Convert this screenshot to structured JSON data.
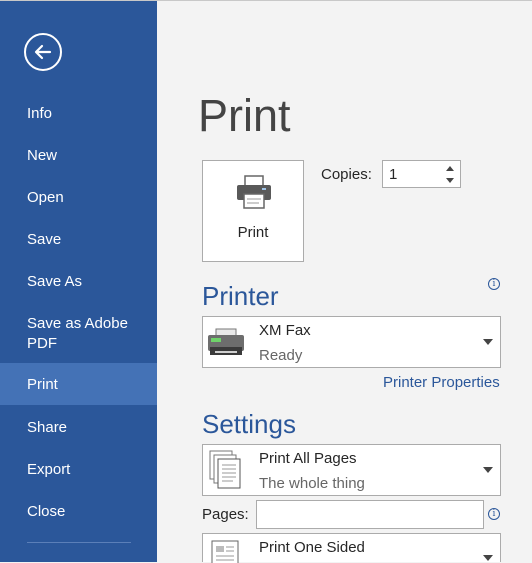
{
  "sidebar": {
    "back_icon": "back-arrow-icon",
    "items": [
      {
        "label": "Info"
      },
      {
        "label": "New"
      },
      {
        "label": "Open"
      },
      {
        "label": "Save"
      },
      {
        "label": "Save As"
      },
      {
        "label": "Save as Adobe PDF"
      },
      {
        "label": "Print",
        "active": true
      },
      {
        "label": "Share"
      },
      {
        "label": "Export"
      },
      {
        "label": "Close"
      }
    ]
  },
  "main": {
    "title": "Print",
    "print_button": {
      "label": "Print",
      "icon": "printer-icon"
    },
    "copies": {
      "label": "Copies:",
      "value": "1"
    },
    "printer": {
      "heading": "Printer",
      "name": "XM Fax",
      "status": "Ready",
      "icon": "fax-printer-icon",
      "properties_link": "Printer Properties"
    },
    "settings": {
      "heading": "Settings",
      "pages_dropdown": {
        "main": "Print All Pages",
        "sub": "The whole thing",
        "icon": "pages-stack-icon"
      },
      "pages_label": "Pages:",
      "pages_value": "",
      "sided_dropdown": {
        "main": "Print One Sided",
        "icon": "one-sided-page-icon"
      }
    }
  },
  "colors": {
    "accent": "#2b579a",
    "sidebar_active": "#4472b6",
    "background": "#f3f3f3"
  }
}
